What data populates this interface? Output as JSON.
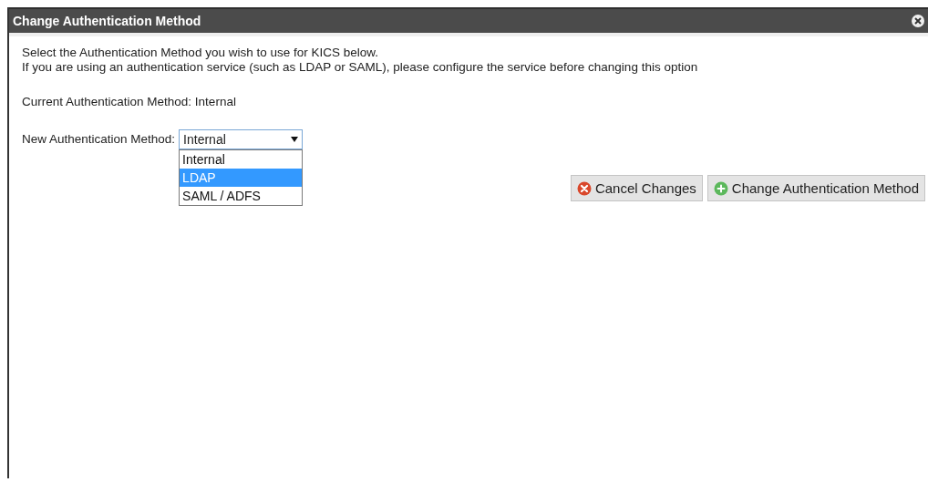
{
  "dialog": {
    "title": "Change Authentication Method"
  },
  "intro": [
    "Select the Authentication Method you wish to use for KICS below.",
    "If you are using an authentication service (such as LDAP or SAML), please configure the service before changing this option"
  ],
  "current": "Current Authentication Method: Internal",
  "new_method": {
    "label": "New Authentication Method:",
    "value": "Internal",
    "expanded": true,
    "options": [
      {
        "label": "Internal",
        "highlighted": false
      },
      {
        "label": "LDAP",
        "highlighted": true
      },
      {
        "label": "SAML / ADFS",
        "highlighted": false
      }
    ]
  },
  "buttons": [
    {
      "kind": "cancel",
      "label": "Cancel Changes"
    },
    {
      "kind": "confirm",
      "label": "Change Authentication Method"
    }
  ]
}
